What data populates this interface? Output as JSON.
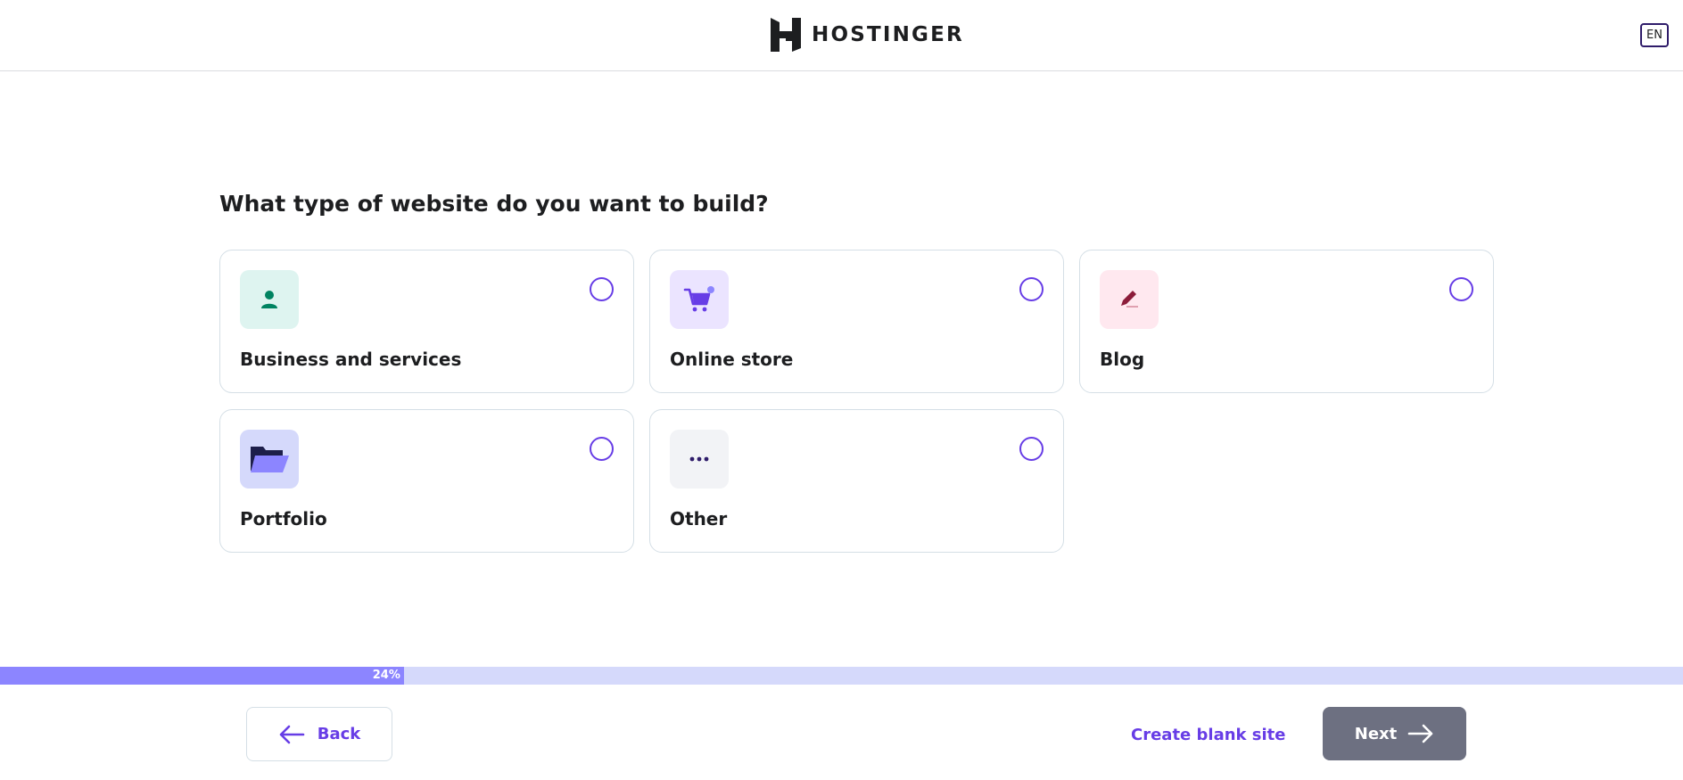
{
  "header": {
    "brand": "HOSTINGER",
    "language": "EN"
  },
  "question": "What type of website do you want to build?",
  "options": [
    {
      "label": "Business and services",
      "icon": "person-icon",
      "icon_bg": "#def4f0",
      "icon_color": "#008361",
      "selected": false
    },
    {
      "label": "Online store",
      "icon": "shopping-cart-icon",
      "icon_bg": "#ebe4ff",
      "icon_color": "#673de6",
      "selected": false
    },
    {
      "label": "Blog",
      "icon": "pen-icon",
      "icon_bg": "#ffe8ef",
      "icon_color": "#8c1c3a",
      "selected": false
    },
    {
      "label": "Portfolio",
      "icon": "folder-icon",
      "icon_bg": "#d5d9fb",
      "icon_color": "#8c85ff",
      "selected": false
    },
    {
      "label": "Other",
      "icon": "more-dots-icon",
      "icon_bg": "#f2f3f6",
      "icon_color": "#2f1c6a",
      "selected": false
    }
  ],
  "progress": {
    "percent": 24,
    "label": "24%"
  },
  "footer": {
    "back_label": "Back",
    "blank_site_label": "Create blank site",
    "next_label": "Next"
  },
  "colors": {
    "accent": "#673de6",
    "progress_fill": "#8c85ff",
    "progress_track": "#d5d9fb",
    "next_button_disabled": "#6d7081"
  }
}
